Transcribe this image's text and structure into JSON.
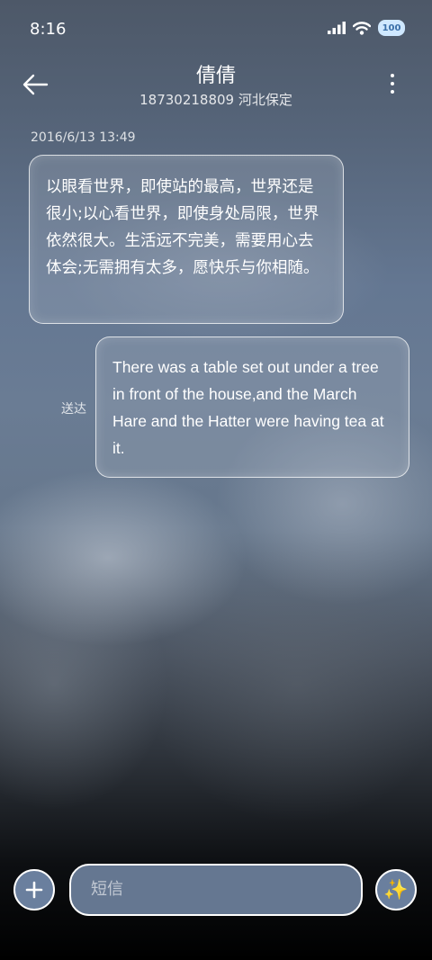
{
  "status_bar": {
    "time": "8:16",
    "battery": "100",
    "icons": [
      "signal-icon",
      "wifi-icon",
      "battery-icon"
    ]
  },
  "header": {
    "contact_name": "倩倩",
    "contact_sub": "18730218809 河北保定",
    "back_icon": "back-arrow-icon",
    "more_icon": "more-vertical-icon"
  },
  "conversation": {
    "timestamp": "2016/6/13 13:49",
    "messages": [
      {
        "direction": "incoming",
        "text": "以眼看世界，即使站的最高，世界还是很小;以心看世界，即使身处局限，世界依然很大。生活远不完美，需要用心去体会;无需拥有太多，愿快乐与你相随。"
      },
      {
        "direction": "outgoing",
        "text": "There was a table set out under a tree in front of the house,and the March Hare and the Hatter were having tea at it.",
        "status": "送达"
      }
    ]
  },
  "input_bar": {
    "placeholder": "短信",
    "add_icon": "plus-icon",
    "ai_icon": "sparkle-icon"
  },
  "colors": {
    "bubble_border": "#ffffff",
    "input_bg": "#657791",
    "button_bg": "#6a7f9e"
  }
}
